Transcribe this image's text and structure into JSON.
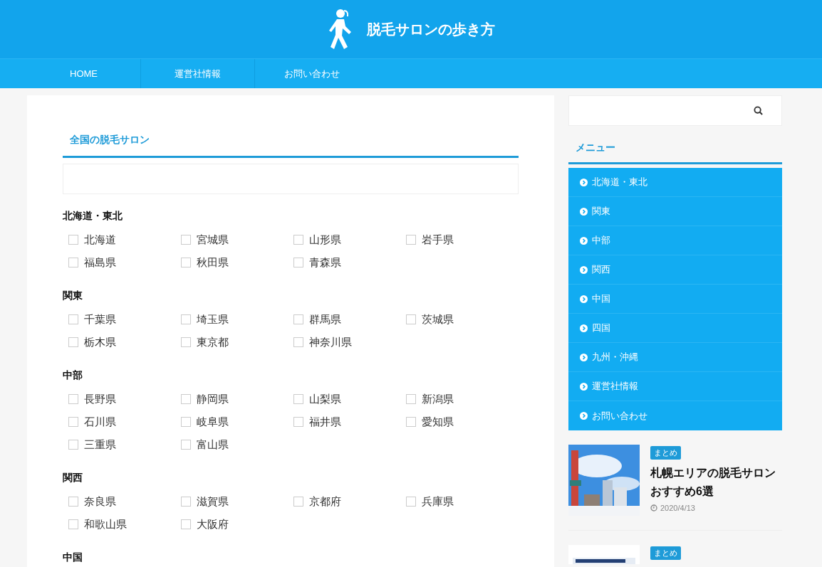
{
  "site": {
    "title": "脱毛サロンの歩き方"
  },
  "nav": [
    {
      "label": "HOME"
    },
    {
      "label": "運営社情報"
    },
    {
      "label": "お問い合わせ"
    }
  ],
  "main": {
    "heading": "全国の脱毛サロン",
    "regions": [
      {
        "name": "北海道・東北",
        "prefectures": [
          {
            "label": "北海道",
            "checked": false
          },
          {
            "label": "宮城県",
            "checked": false
          },
          {
            "label": "山形県",
            "checked": false
          },
          {
            "label": "岩手県",
            "checked": false
          },
          {
            "label": "福島県",
            "checked": false
          },
          {
            "label": "秋田県",
            "checked": false
          },
          {
            "label": "青森県",
            "checked": false
          }
        ]
      },
      {
        "name": "関東",
        "prefectures": [
          {
            "label": "千葉県",
            "checked": false
          },
          {
            "label": "埼玉県",
            "checked": false
          },
          {
            "label": "群馬県",
            "checked": false
          },
          {
            "label": "茨城県",
            "checked": false
          },
          {
            "label": "栃木県",
            "checked": false
          },
          {
            "label": "東京都",
            "checked": false
          },
          {
            "label": "神奈川県",
            "checked": false
          }
        ]
      },
      {
        "name": "中部",
        "prefectures": [
          {
            "label": "長野県",
            "checked": false
          },
          {
            "label": "静岡県",
            "checked": false
          },
          {
            "label": "山梨県",
            "checked": false
          },
          {
            "label": "新潟県",
            "checked": false
          },
          {
            "label": "石川県",
            "checked": false
          },
          {
            "label": "岐阜県",
            "checked": false
          },
          {
            "label": "福井県",
            "checked": false
          },
          {
            "label": "愛知県",
            "checked": false
          },
          {
            "label": "三重県",
            "checked": false
          },
          {
            "label": "富山県",
            "checked": false
          }
        ]
      },
      {
        "name": "関西",
        "prefectures": [
          {
            "label": "奈良県",
            "checked": false
          },
          {
            "label": "滋賀県",
            "checked": false
          },
          {
            "label": "京都府",
            "checked": false
          },
          {
            "label": "兵庫県",
            "checked": false
          },
          {
            "label": "和歌山県",
            "checked": false
          },
          {
            "label": "大阪府",
            "checked": false
          }
        ]
      },
      {
        "name": "中国"
      }
    ]
  },
  "sidebar": {
    "menu_title": "メニュー",
    "menu": [
      {
        "label": "北海道・東北"
      },
      {
        "label": "関東"
      },
      {
        "label": "中部"
      },
      {
        "label": "関西"
      },
      {
        "label": "中国"
      },
      {
        "label": "四国"
      },
      {
        "label": "九州・沖縄"
      },
      {
        "label": "運営社情報"
      },
      {
        "label": "お問い合わせ"
      }
    ],
    "posts": [
      {
        "tag": "まとめ",
        "title": "札幌エリアの脱毛サロンおすすめ6選",
        "date": "2020/4/13"
      },
      {
        "tag": "まとめ"
      }
    ]
  }
}
